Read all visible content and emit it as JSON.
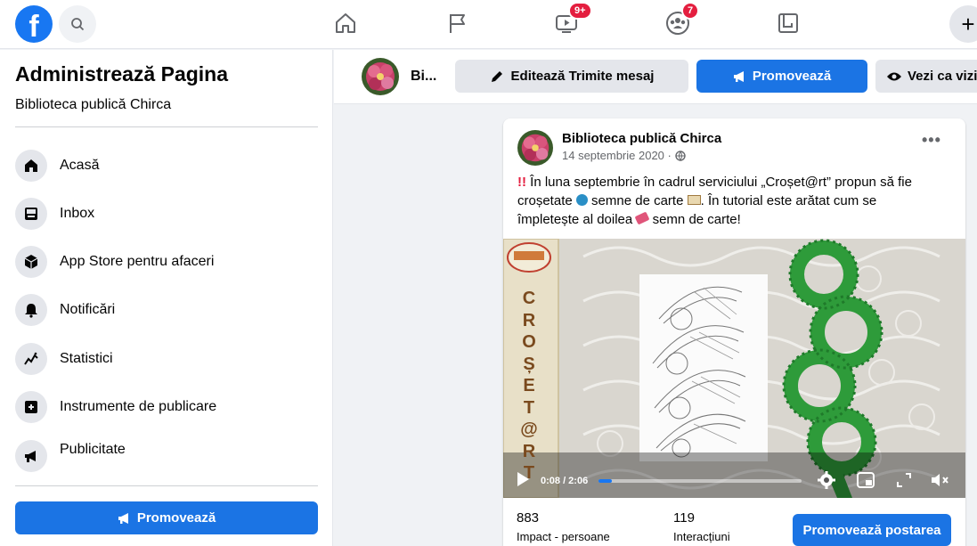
{
  "topbar": {
    "logo_letter": "f",
    "messages_badge": "9+",
    "groups_badge": "7"
  },
  "sidebar": {
    "title": "Administrează Pagina",
    "page_name": "Biblioteca publică Chirca",
    "items": [
      {
        "label": "Acasă",
        "icon": "home-icon"
      },
      {
        "label": "Inbox",
        "icon": "inbox-icon"
      },
      {
        "label": "App Store pentru afaceri",
        "icon": "cube-icon"
      },
      {
        "label": "Notificări",
        "icon": "bell-icon"
      },
      {
        "label": "Statistici",
        "icon": "chart-line-icon"
      },
      {
        "label": "Instrumente de publicare",
        "icon": "publishing-tools-icon"
      },
      {
        "label": "Publicitate",
        "icon": "megaphone-icon"
      }
    ],
    "promote_label": "Promovează"
  },
  "pagebar": {
    "short_name": "Bi...",
    "edit_label": "Editează Trimite mesaj",
    "promote_label": "Promovează",
    "view_label": "Vezi ca vizit"
  },
  "post": {
    "author": "Biblioteca publică Chirca",
    "date": "14 septembrie 2020 ·",
    "text_line1_a": "În luna septembrie în cadrul serviciului „Croșet@rt” propun să fie",
    "text_line2_a": "croșetate",
    "text_line2_b": "semne de carte",
    "text_line2_c": ". În tutorial este arătat cum se",
    "text_line3_a": "împletește al doilea",
    "text_line3_b": "semn de carte!",
    "video": {
      "vertical_title": [
        "C",
        "R",
        "O",
        "Ș",
        "E",
        "T",
        "@",
        "R",
        "T"
      ],
      "time": "0:08 / 2:06",
      "progress": 0.064
    },
    "stats": {
      "reach_value": "883",
      "reach_label": "Impact - persoane",
      "engagement_value": "119",
      "engagement_label": "Interacțiuni"
    },
    "boost_label": "Promovează postarea"
  },
  "colors": {
    "brand": "#1877f2",
    "button_blue": "#1b74e4",
    "badge_red": "#e41e3f",
    "crochet_green": "#2e9b3a"
  }
}
